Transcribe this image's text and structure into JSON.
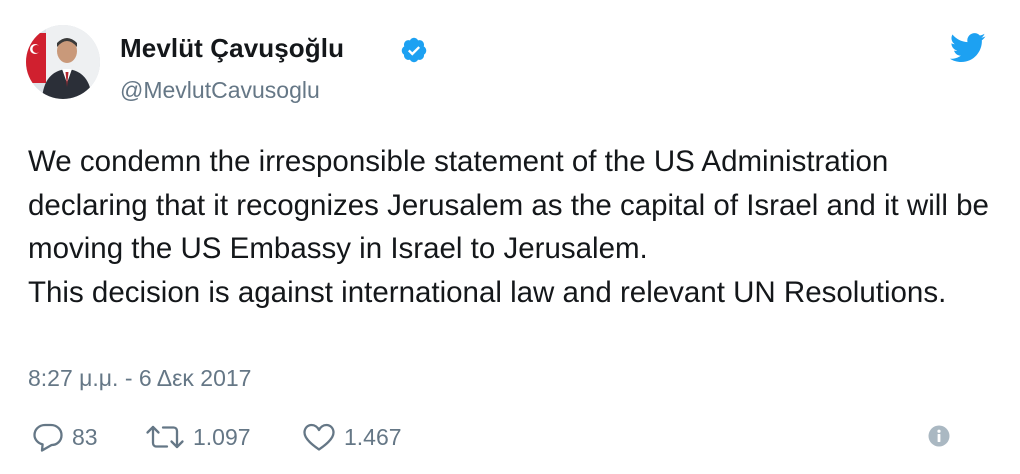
{
  "user": {
    "display_name": "Mevlüt Çavuşoğlu",
    "handle": "@MevlutCavusoglu",
    "verified": true,
    "avatar_icon": "profile-photo"
  },
  "tweet": {
    "paragraphs": [
      "We condemn the irresponsible statement of the US Administration declaring that it recognizes Jerusalem as the capital of Israel and it will be moving the US Embassy in Israel to Jerusalem.",
      "This decision is against international law and relevant UN Resolutions."
    ],
    "timestamp": "8:27 μ.μ. - 6 Δεκ 2017"
  },
  "actions": {
    "replies": "83",
    "retweets": "1.097",
    "likes": "1.467"
  },
  "icons": {
    "brand": "twitter-bird-icon",
    "verified": "verified-badge-icon",
    "reply": "reply-icon",
    "retweet": "retweet-icon",
    "like": "heart-icon",
    "info": "info-icon"
  },
  "colors": {
    "brand": "#1da1f2",
    "text": "#14171a",
    "secondary": "#657786",
    "info_icon": "#aab8c2"
  }
}
